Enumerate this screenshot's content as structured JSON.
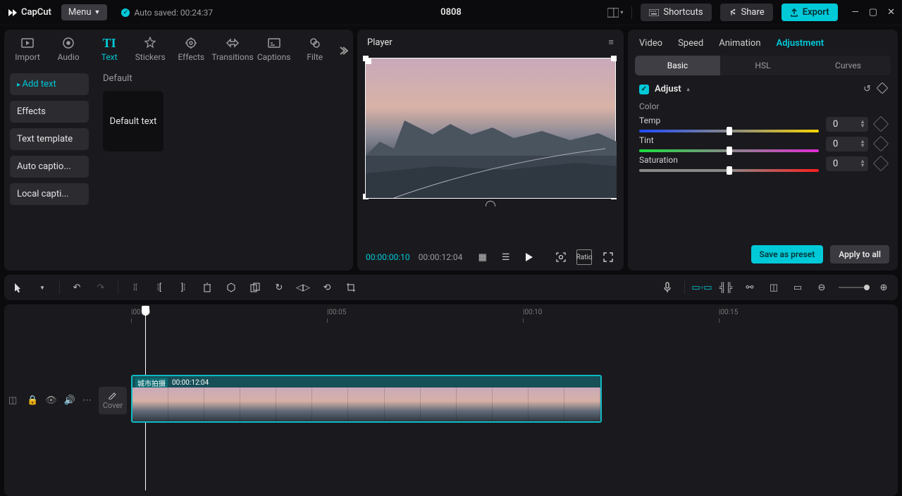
{
  "header": {
    "app": "CapCut",
    "menu": "Menu",
    "auto_saved": "Auto saved: 00:24:37",
    "title": "0808",
    "shortcuts": "Shortcuts",
    "share": "Share",
    "export": "Export"
  },
  "media_tabs": [
    "Import",
    "Audio",
    "Text",
    "Stickers",
    "Effects",
    "Transitions",
    "Captions",
    "Filte"
  ],
  "media_active": 2,
  "text_side": [
    "Add text",
    "Effects",
    "Text template",
    "Auto captio...",
    "Local capti..."
  ],
  "text_side_active": 0,
  "left_content": {
    "category": "Default",
    "thumb_label": "Default text"
  },
  "player": {
    "title": "Player",
    "current": "00:00:00:10",
    "duration": "00:00:12:04",
    "ratio": "Ratio"
  },
  "right": {
    "tabs": [
      "Video",
      "Speed",
      "Animation",
      "Adjustment"
    ],
    "active": 3,
    "subtabs": [
      "Basic",
      "HSL",
      "Curves"
    ],
    "subactive": 0,
    "adjust": "Adjust",
    "sections": {
      "color": "Color"
    },
    "sliders": [
      {
        "name": "Temp",
        "value": 0,
        "gradient": "linear-gradient(90deg,#1e4bff,#888,#f5d400)"
      },
      {
        "name": "Tint",
        "value": 0,
        "gradient": "linear-gradient(90deg,#1adf3e,#888,#e22bd6)"
      },
      {
        "name": "Saturation",
        "value": 0,
        "gradient": "linear-gradient(90deg,#888,#888,#ff1e1e)"
      }
    ],
    "save_preset": "Save as preset",
    "apply_all": "Apply to all"
  },
  "timeline": {
    "cover": "Cover",
    "ticks": [
      "|00:00",
      "|00:05",
      "|00:10",
      "|00:15"
    ],
    "clip": {
      "tag": "城市拍摄",
      "dur": "00:00:12:04"
    }
  }
}
